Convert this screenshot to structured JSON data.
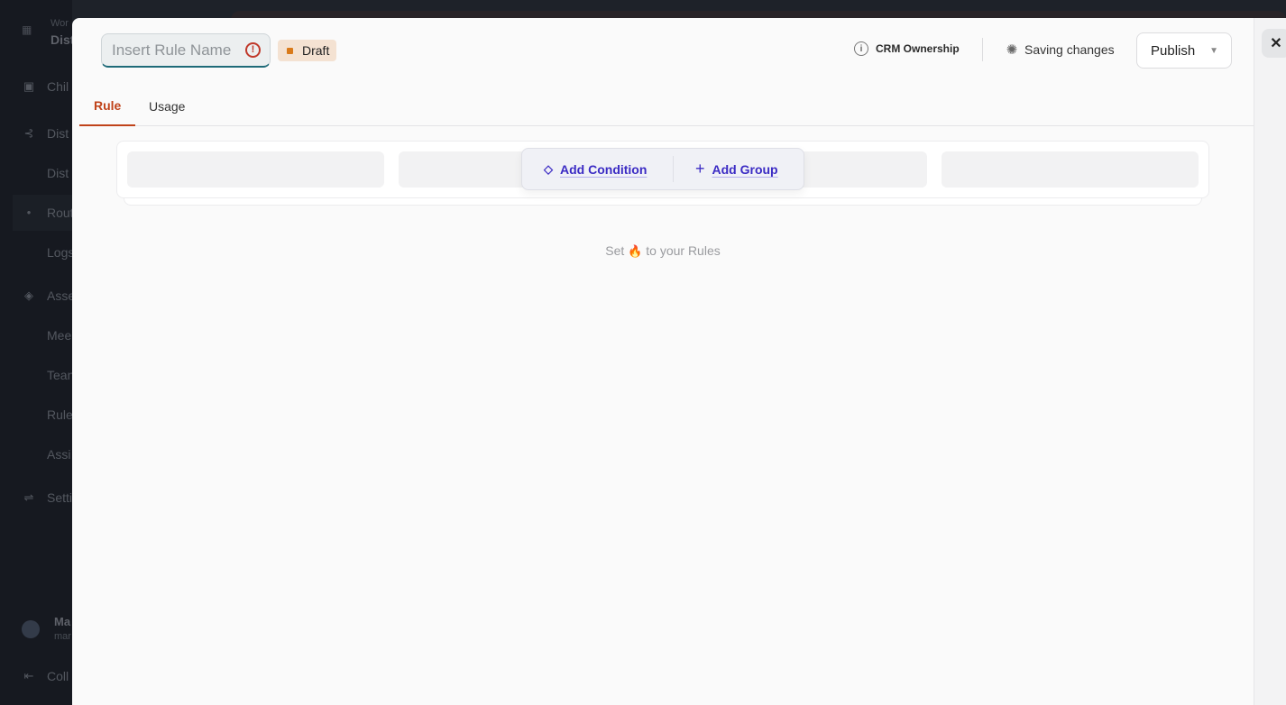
{
  "background": {
    "workspace_label": "Wor",
    "workspace_name": "Dist",
    "nav": [
      {
        "icon": "calendar-icon",
        "label": "Chil"
      },
      {
        "icon": "branch-icon",
        "label": "Dist"
      },
      {
        "icon": "",
        "label": "Dist"
      },
      {
        "icon": "dot-icon",
        "label": "Rout"
      },
      {
        "icon": "",
        "label": "Logs"
      },
      {
        "icon": "layers-icon",
        "label": "Asse"
      },
      {
        "icon": "",
        "label": "Mee"
      },
      {
        "icon": "",
        "label": "Tean"
      },
      {
        "icon": "",
        "label": "Rule"
      },
      {
        "icon": "",
        "label": "Assi"
      },
      {
        "icon": "sliders-icon",
        "label": "Setti"
      }
    ],
    "user_name": "Ma",
    "user_email": "mar",
    "collapse_label": "Coll"
  },
  "header": {
    "rule_name_value": "",
    "rule_name_placeholder": "Insert Rule Name",
    "status_badge": "Draft",
    "crm_ownership": "CRM Ownership",
    "saving_status": "Saving changes",
    "publish_label": "Publish"
  },
  "tabs": [
    {
      "label": "Rule",
      "active": true
    },
    {
      "label": "Usage",
      "active": false
    }
  ],
  "toolbar": {
    "add_condition": "Add Condition",
    "add_group": "Add Group"
  },
  "empty_hint": {
    "before": "Set",
    "emoji": "🔥",
    "after": "to your Rules"
  },
  "colors": {
    "accent_tab": "#c0431a",
    "action_purple": "#3b2bc4",
    "draft_badge_bg": "#f4e2d2",
    "warning_red": "#c0392b"
  }
}
